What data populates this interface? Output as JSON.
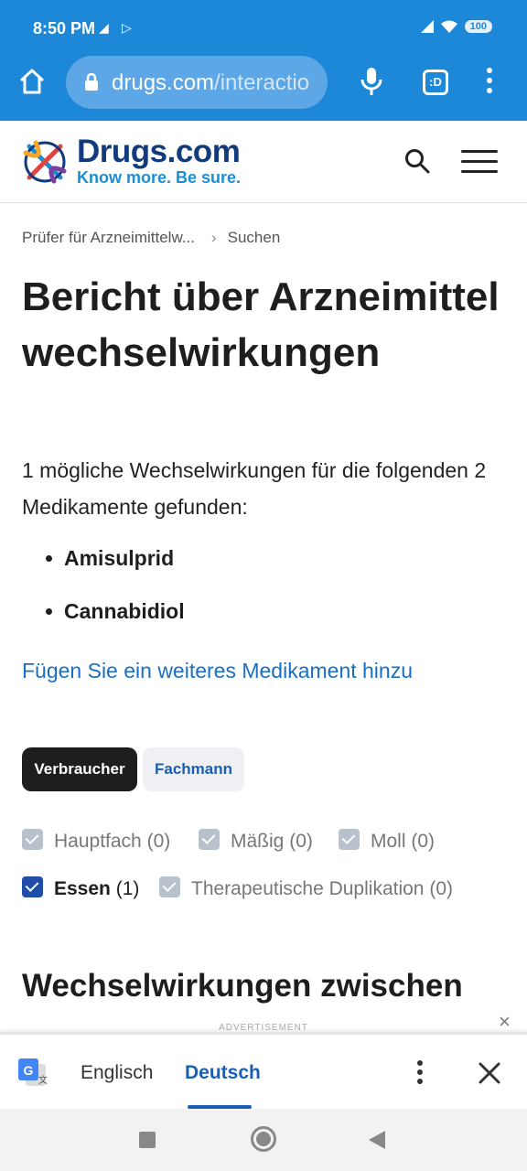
{
  "status_bar": {
    "time": "8:50 PM",
    "battery": "100"
  },
  "browser": {
    "url_host": "drugs.com",
    "url_path": "/interactio",
    "tabs_label": ":D"
  },
  "site": {
    "brand": "Drugs.com",
    "tagline": "Know more. Be sure."
  },
  "breadcrumb": {
    "item1": "Prüfer für Arzneimittelw...",
    "item2": "Suchen"
  },
  "page": {
    "title": "Bericht über Arzneimittelwechselwirkungen",
    "intro": "1 mögliche Wechselwirkungen für die folgenden 2 Medikamente gefunden:",
    "drugs": [
      "Amisulprid",
      "Cannabidiol"
    ],
    "add_link": "Fügen Sie ein weiteres Medikament hinzu",
    "section_heading": "Wechselwirkungen zwischen"
  },
  "audience_toggle": {
    "active": "Verbraucher",
    "inactive": "Fachmann"
  },
  "filters": [
    {
      "label": "Hauptfach",
      "count": "(0)",
      "checked": false
    },
    {
      "label": "Mäßig",
      "count": "(0)",
      "checked": false
    },
    {
      "label": "Moll",
      "count": "(0)",
      "checked": false
    },
    {
      "label": "Essen",
      "count": "(1)",
      "checked": true
    },
    {
      "label": "Therapeutische Duplikation",
      "count": "(0)",
      "checked": false
    }
  ],
  "ad": {
    "label": "ADVERTISEMENT"
  },
  "translate_bar": {
    "source_lang": "Englisch",
    "target_lang": "Deutsch"
  },
  "colors": {
    "browser_bar": "#1e88d8",
    "brand_navy": "#123b7d",
    "brand_blue": "#1a8fd6",
    "link": "#1a6fc0",
    "checkbox_checked": "#1f4da8"
  }
}
